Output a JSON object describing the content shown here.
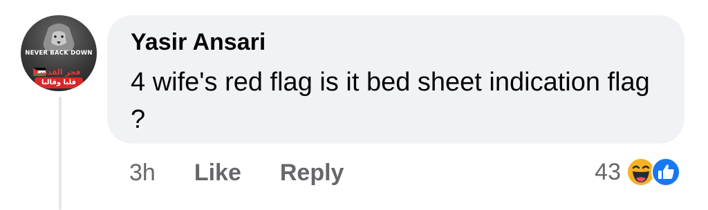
{
  "comment": {
    "author": "Yasir Ansari",
    "text": "4 wife's red flag is it bed sheet indication flag ?",
    "time": "3h",
    "like_label": "Like",
    "reply_label": "Reply",
    "reaction_count": "43",
    "reactions": [
      "haha-icon",
      "like-icon"
    ]
  },
  "avatar": {
    "caption_top": "NEVER BACK DOWN",
    "arabic_line1": "فجر القدس",
    "arabic_line2": "قلبا وقالبا"
  },
  "colors": {
    "bubble": "#f0f2f5",
    "secondary_text": "#65676b",
    "primary_text": "#050505",
    "like_blue": "#1877f2",
    "haha_yellow": "#f7b125"
  }
}
